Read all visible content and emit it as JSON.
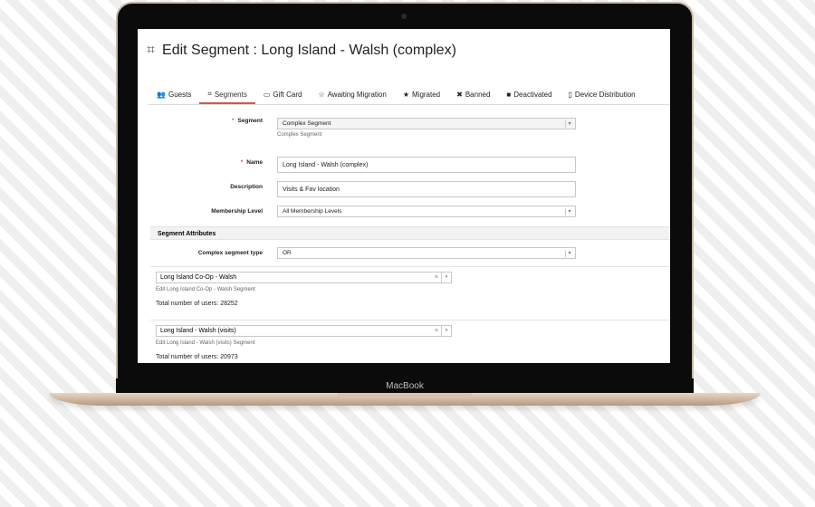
{
  "device": {
    "brand_label": "MacBook"
  },
  "page": {
    "title": "Edit Segment : Long Island - Walsh (complex)"
  },
  "tabs": [
    {
      "icon": "users-icon",
      "label": "Guests"
    },
    {
      "icon": "crop-icon",
      "label": "Segments"
    },
    {
      "icon": "credit-card-icon",
      "label": "Gift Card"
    },
    {
      "icon": "star-outline-icon",
      "label": "Awaiting Migration"
    },
    {
      "icon": "star-icon",
      "label": "Migrated"
    },
    {
      "icon": "close-icon",
      "label": "Banned"
    },
    {
      "icon": "square-icon",
      "label": "Deactivated"
    },
    {
      "icon": "mobile-icon",
      "label": "Device Distribution"
    }
  ],
  "form": {
    "segment": {
      "label": "Segment",
      "value": "Complex Segment",
      "help": "Complex Segment"
    },
    "name": {
      "label": "Name",
      "value": "Long Island - Walsh (complex)"
    },
    "description": {
      "label": "Description",
      "value": "Visits & Fav location"
    },
    "membership": {
      "label": "Membership Level",
      "value": "All Membership Levels"
    }
  },
  "attributes": {
    "heading": "Segment Attributes",
    "type_label": "Complex segment type",
    "type_value": "OR",
    "segments": [
      {
        "value": "Long Island Co-Op - Walsh",
        "edit_link": "Edit Long Island Co-Op - Walsh Segment",
        "total": "Total number of users: 28252"
      },
      {
        "value": "Long Island - Walsh (visits)",
        "edit_link": "Edit Long Island - Walsh (visits) Segment",
        "total": "Total number of users: 20973"
      }
    ]
  }
}
